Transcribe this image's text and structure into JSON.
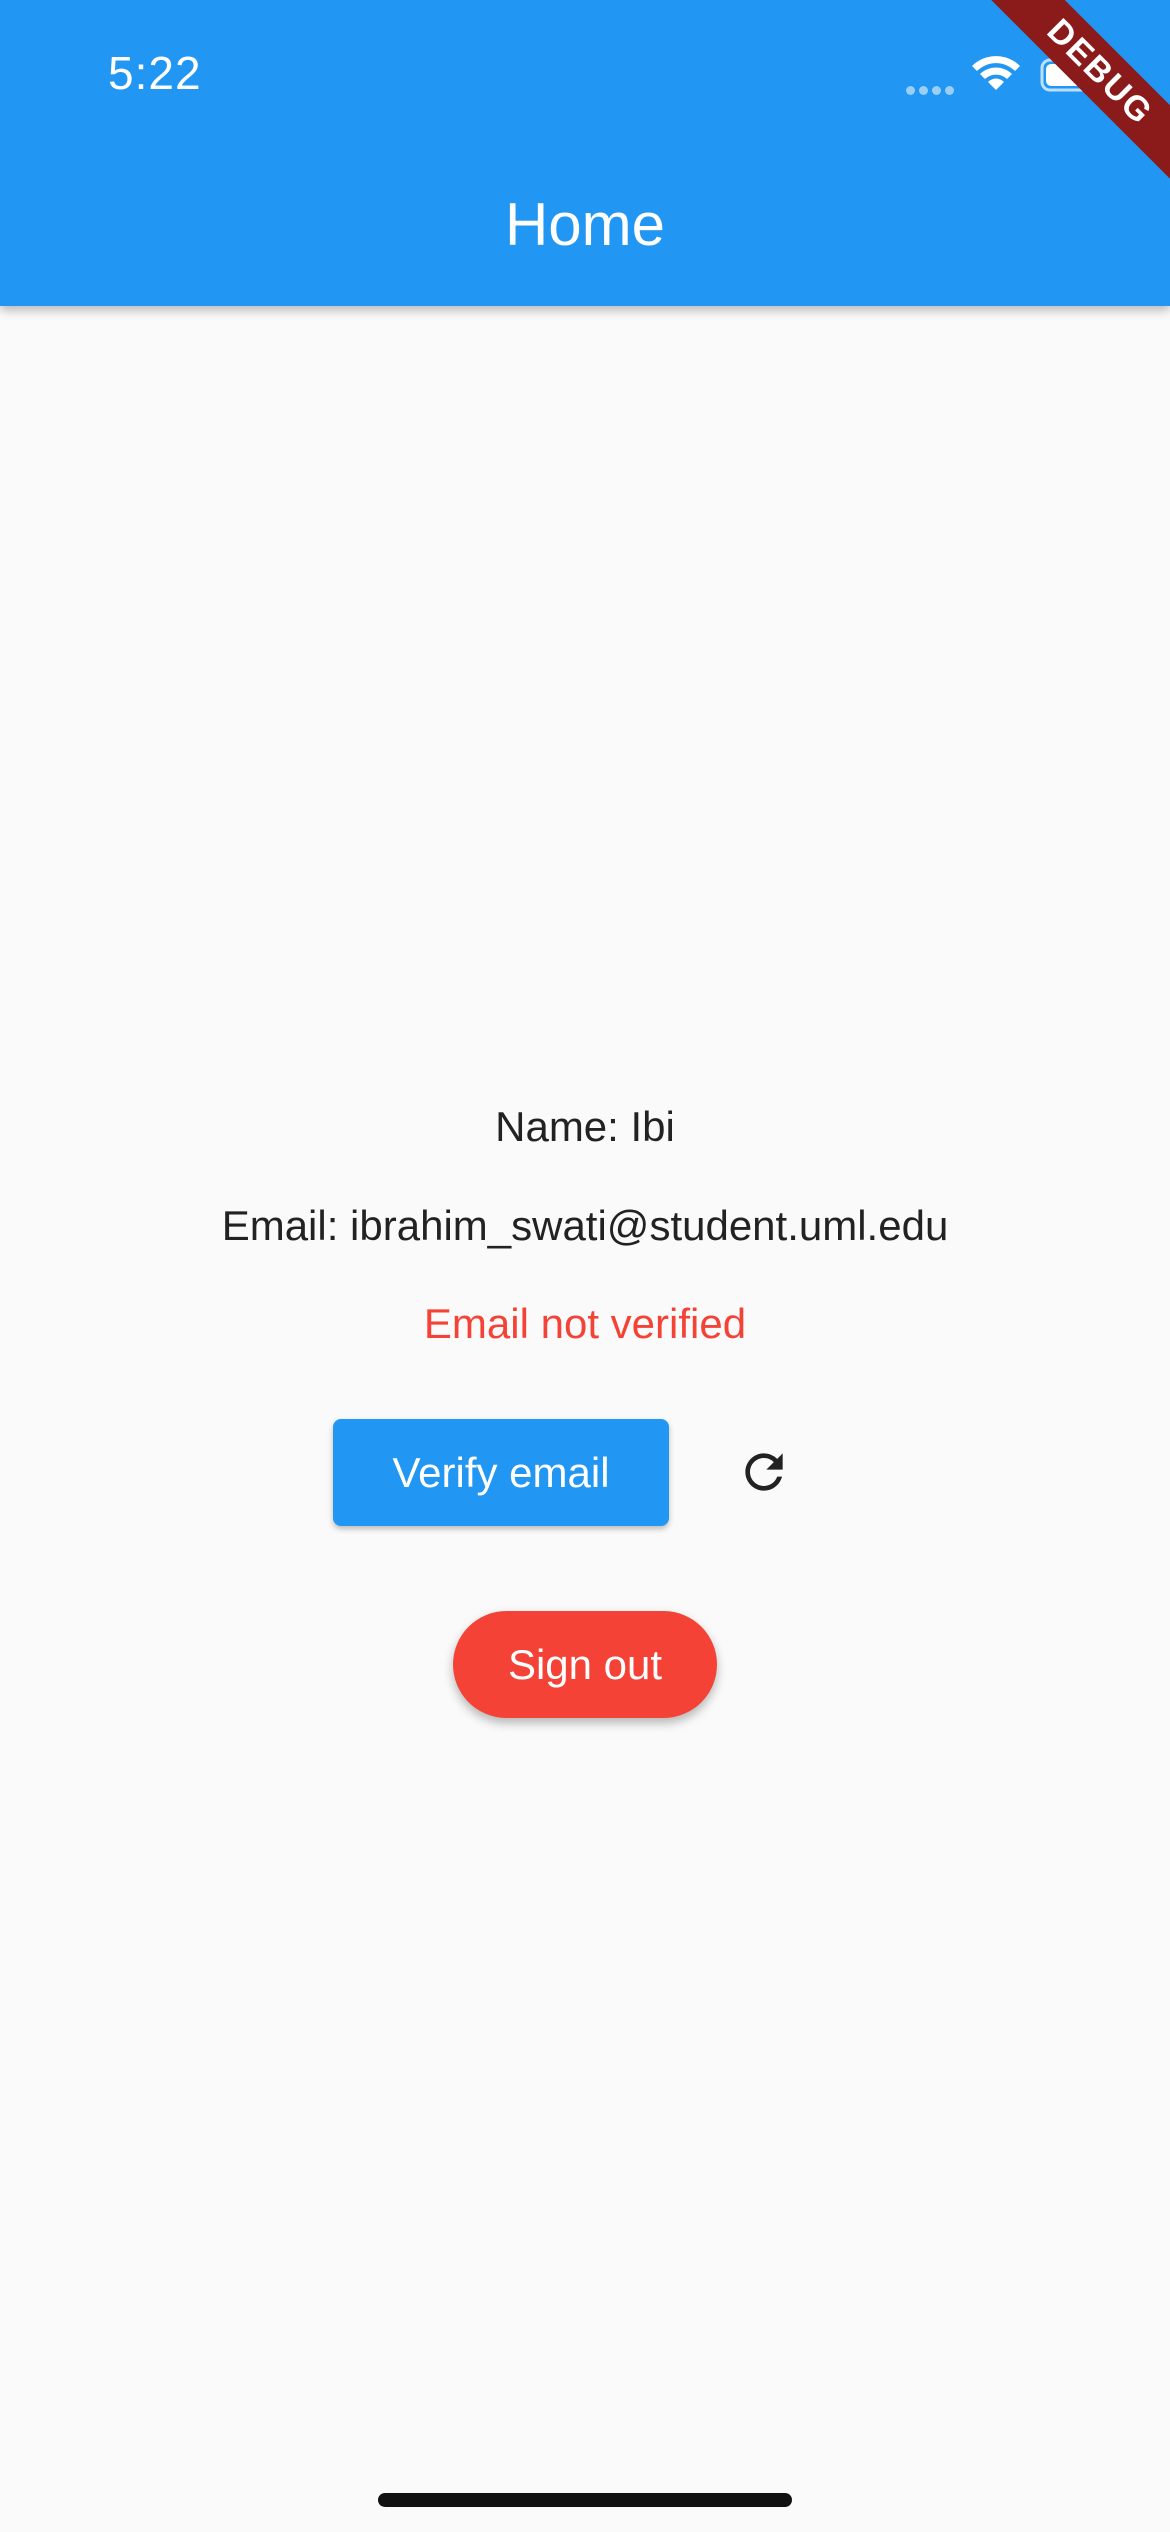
{
  "status_bar": {
    "time": "5:22"
  },
  "app_bar": {
    "title": "Home",
    "color": "#2196f3"
  },
  "debug_banner": {
    "label": "DEBUG"
  },
  "profile": {
    "name_text": "Name: Ibi",
    "email_text": "Email: ibrahim_swati@student.uml.edu",
    "verification_status": "Email not verified"
  },
  "actions": {
    "verify_label": "Verify email",
    "refresh_icon": "refresh-icon",
    "sign_out_label": "Sign out"
  },
  "colors": {
    "primary": "#2196f3",
    "danger": "#f44336",
    "background": "#fafafa"
  }
}
